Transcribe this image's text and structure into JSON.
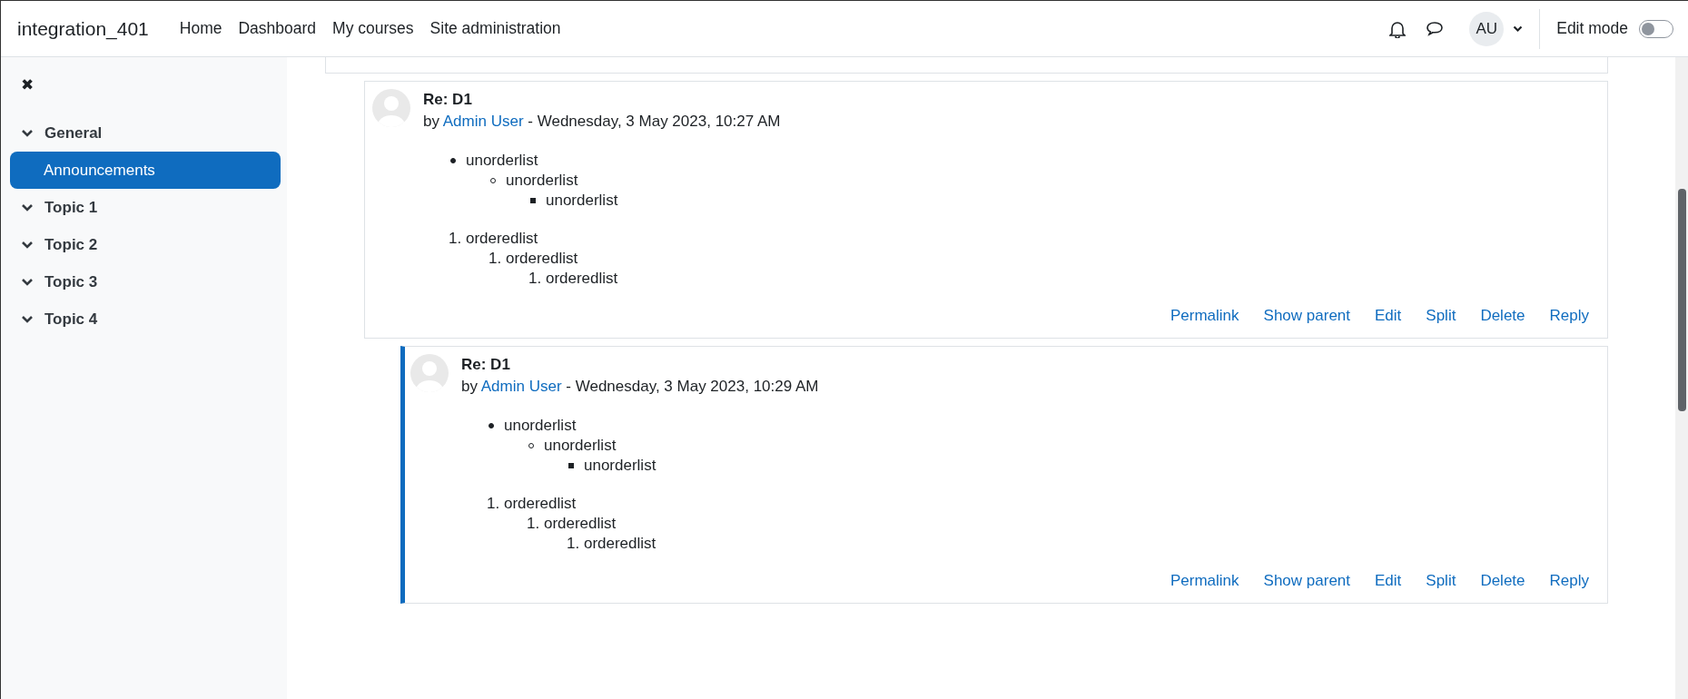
{
  "navbar": {
    "site_name": "integration_401",
    "links": [
      {
        "label": "Home"
      },
      {
        "label": "Dashboard"
      },
      {
        "label": "My courses"
      },
      {
        "label": "Site administration"
      }
    ],
    "user_initials": "AU",
    "edit_mode": {
      "label": "Edit mode",
      "on": false
    }
  },
  "sidebar": {
    "close_glyph": "✖",
    "sections": [
      {
        "label": "General",
        "expanded": true,
        "children": [
          {
            "label": "Announcements",
            "selected": true
          }
        ]
      },
      {
        "label": "Topic 1",
        "expanded": true
      },
      {
        "label": "Topic 2",
        "expanded": true
      },
      {
        "label": "Topic 3",
        "expanded": true
      },
      {
        "label": "Topic 4",
        "expanded": true
      }
    ]
  },
  "posts": [
    {
      "title": "Re: D1",
      "by": "by",
      "author": "Admin User",
      "date": "- Wednesday, 3 May 2023, 10:27 AM",
      "highlighted": false,
      "unordered": [
        {
          "text": "unorderlist",
          "children": [
            {
              "text": "unorderlist",
              "children": [
                {
                  "text": "unorderlist"
                }
              ]
            }
          ]
        }
      ],
      "ordered": [
        {
          "marker": "1.",
          "text": "orderedlist",
          "children": [
            {
              "marker": "1.",
              "text": "orderedlist",
              "children": [
                {
                  "marker": "1.",
                  "text": "orderedlist"
                }
              ]
            }
          ]
        }
      ],
      "actions": [
        "Permalink",
        "Show parent",
        "Edit",
        "Split",
        "Delete",
        "Reply"
      ]
    },
    {
      "title": "Re: D1",
      "by": "by",
      "author": "Admin User",
      "date": "- Wednesday, 3 May 2023, 10:29 AM",
      "highlighted": true,
      "unordered": [
        {
          "text": "unorderlist",
          "children": [
            {
              "text": "unorderlist",
              "children": [
                {
                  "text": "unorderlist"
                }
              ]
            }
          ]
        }
      ],
      "ordered": [
        {
          "marker": "1.",
          "text": "orderedlist",
          "children": [
            {
              "marker": "1.",
              "text": "orderedlist",
              "children": [
                {
                  "marker": "1.",
                  "text": "orderedlist"
                }
              ]
            }
          ]
        }
      ],
      "actions": [
        "Permalink",
        "Show parent",
        "Edit",
        "Split",
        "Delete",
        "Reply"
      ]
    }
  ]
}
